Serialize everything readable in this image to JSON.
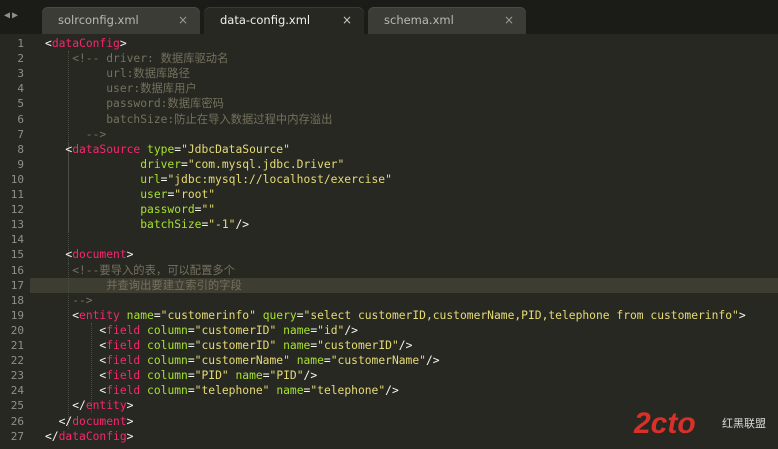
{
  "tabs": [
    {
      "label": "solrconfig.xml",
      "active": false
    },
    {
      "label": "data-config.xml",
      "active": true
    },
    {
      "label": "schema.xml",
      "active": false
    }
  ],
  "nav": {
    "prev_icon": "triangle-left",
    "next_icon": "triangle-right"
  },
  "close_glyph": "×",
  "highlighted_line": 17,
  "lines": [
    {
      "n": "1",
      "parts": [
        [
          "p",
          "<"
        ],
        [
          "t",
          "dataConfig"
        ],
        [
          "p",
          ">"
        ]
      ]
    },
    {
      "n": "2",
      "parts": [
        [
          "c",
          "    <!-- driver: 数据库驱动名"
        ]
      ]
    },
    {
      "n": "3",
      "parts": [
        [
          "c",
          "         url:数据库路径"
        ]
      ]
    },
    {
      "n": "4",
      "parts": [
        [
          "c",
          "         user:数据库用户"
        ]
      ]
    },
    {
      "n": "5",
      "parts": [
        [
          "c",
          "         password:数据库密码"
        ]
      ]
    },
    {
      "n": "6",
      "parts": [
        [
          "c",
          "         batchSize:防止在导入数据过程中内存溢出"
        ]
      ]
    },
    {
      "n": "7",
      "parts": [
        [
          "c",
          "      -->"
        ]
      ]
    },
    {
      "n": "8",
      "parts": [
        [
          "p",
          "   <"
        ],
        [
          "t",
          "dataSource"
        ],
        [
          "p",
          " "
        ],
        [
          "a",
          "type"
        ],
        [
          "p",
          "="
        ],
        [
          "s",
          "\"JdbcDataSource\""
        ]
      ]
    },
    {
      "n": "9",
      "parts": [
        [
          "p",
          "              "
        ],
        [
          "a",
          "driver"
        ],
        [
          "p",
          "="
        ],
        [
          "s",
          "\"com.mysql.jdbc.Driver\""
        ]
      ]
    },
    {
      "n": "10",
      "parts": [
        [
          "p",
          "              "
        ],
        [
          "a",
          "url"
        ],
        [
          "p",
          "="
        ],
        [
          "s",
          "\"jdbc:mysql://localhost/exercise\""
        ]
      ]
    },
    {
      "n": "11",
      "parts": [
        [
          "p",
          "              "
        ],
        [
          "a",
          "user"
        ],
        [
          "p",
          "="
        ],
        [
          "s",
          "\"root\""
        ]
      ]
    },
    {
      "n": "12",
      "parts": [
        [
          "p",
          "              "
        ],
        [
          "a",
          "password"
        ],
        [
          "p",
          "="
        ],
        [
          "s",
          "\"\""
        ]
      ]
    },
    {
      "n": "13",
      "parts": [
        [
          "p",
          "              "
        ],
        [
          "a",
          "batchSize"
        ],
        [
          "p",
          "="
        ],
        [
          "s",
          "\"-1\""
        ],
        [
          "p",
          "/>"
        ]
      ]
    },
    {
      "n": "14",
      "parts": []
    },
    {
      "n": "15",
      "parts": [
        [
          "p",
          "   <"
        ],
        [
          "t",
          "document"
        ],
        [
          "p",
          ">"
        ]
      ]
    },
    {
      "n": "16",
      "parts": [
        [
          "c",
          "    <!--要导入的表，可以配置多个"
        ]
      ]
    },
    {
      "n": "17",
      "parts": [
        [
          "c",
          "         并查询出要建立索引的字段"
        ]
      ]
    },
    {
      "n": "18",
      "parts": [
        [
          "c",
          "    -->"
        ]
      ]
    },
    {
      "n": "19",
      "parts": [
        [
          "p",
          "    <"
        ],
        [
          "t",
          "entity"
        ],
        [
          "p",
          " "
        ],
        [
          "a",
          "name"
        ],
        [
          "p",
          "="
        ],
        [
          "s",
          "\"customerinfo\""
        ],
        [
          "p",
          " "
        ],
        [
          "a",
          "query"
        ],
        [
          "p",
          "="
        ],
        [
          "s",
          "\"select customerID,customerName,PID,telephone from customerinfo\""
        ],
        [
          "p",
          ">"
        ]
      ]
    },
    {
      "n": "20",
      "parts": [
        [
          "p",
          "        <"
        ],
        [
          "t",
          "field"
        ],
        [
          "p",
          " "
        ],
        [
          "a",
          "column"
        ],
        [
          "p",
          "="
        ],
        [
          "s",
          "\"customerID\""
        ],
        [
          "p",
          " "
        ],
        [
          "a",
          "name"
        ],
        [
          "p",
          "="
        ],
        [
          "s",
          "\"id\""
        ],
        [
          "p",
          "/>"
        ]
      ]
    },
    {
      "n": "21",
      "parts": [
        [
          "p",
          "        <"
        ],
        [
          "t",
          "field"
        ],
        [
          "p",
          " "
        ],
        [
          "a",
          "column"
        ],
        [
          "p",
          "="
        ],
        [
          "s",
          "\"customerID\""
        ],
        [
          "p",
          " "
        ],
        [
          "a",
          "name"
        ],
        [
          "p",
          "="
        ],
        [
          "s",
          "\"customerID\""
        ],
        [
          "p",
          "/>"
        ]
      ]
    },
    {
      "n": "22",
      "parts": [
        [
          "p",
          "        <"
        ],
        [
          "t",
          "field"
        ],
        [
          "p",
          " "
        ],
        [
          "a",
          "column"
        ],
        [
          "p",
          "="
        ],
        [
          "s",
          "\"customerName\""
        ],
        [
          "p",
          " "
        ],
        [
          "a",
          "name"
        ],
        [
          "p",
          "="
        ],
        [
          "s",
          "\"customerName\""
        ],
        [
          "p",
          "/>"
        ]
      ]
    },
    {
      "n": "23",
      "parts": [
        [
          "p",
          "        <"
        ],
        [
          "t",
          "field"
        ],
        [
          "p",
          " "
        ],
        [
          "a",
          "column"
        ],
        [
          "p",
          "="
        ],
        [
          "s",
          "\"PID\""
        ],
        [
          "p",
          " "
        ],
        [
          "a",
          "name"
        ],
        [
          "p",
          "="
        ],
        [
          "s",
          "\"PID\""
        ],
        [
          "p",
          "/>"
        ]
      ]
    },
    {
      "n": "24",
      "parts": [
        [
          "p",
          "        <"
        ],
        [
          "t",
          "field"
        ],
        [
          "p",
          " "
        ],
        [
          "a",
          "column"
        ],
        [
          "p",
          "="
        ],
        [
          "s",
          "\"telephone\""
        ],
        [
          "p",
          " "
        ],
        [
          "a",
          "name"
        ],
        [
          "p",
          "="
        ],
        [
          "s",
          "\"telephone\""
        ],
        [
          "p",
          "/>"
        ]
      ]
    },
    {
      "n": "25",
      "parts": [
        [
          "p",
          "    </"
        ],
        [
          "t",
          "entity"
        ],
        [
          "p",
          ">"
        ]
      ]
    },
    {
      "n": "26",
      "parts": [
        [
          "p",
          "  </"
        ],
        [
          "t",
          "document"
        ],
        [
          "p",
          ">"
        ]
      ]
    },
    {
      "n": "27",
      "parts": [
        [
          "p",
          "</"
        ],
        [
          "t",
          "dataConfig"
        ],
        [
          "p",
          ">"
        ]
      ]
    }
  ],
  "watermark": {
    "text": "2cto",
    "subtext": "红黑联盟",
    "color": "#d9302a"
  },
  "colors": {
    "background": "#272822",
    "tag": "#f92672",
    "attribute": "#a6e22e",
    "string": "#e6db74",
    "comment": "#75715e",
    "text": "#f8f8f2"
  }
}
